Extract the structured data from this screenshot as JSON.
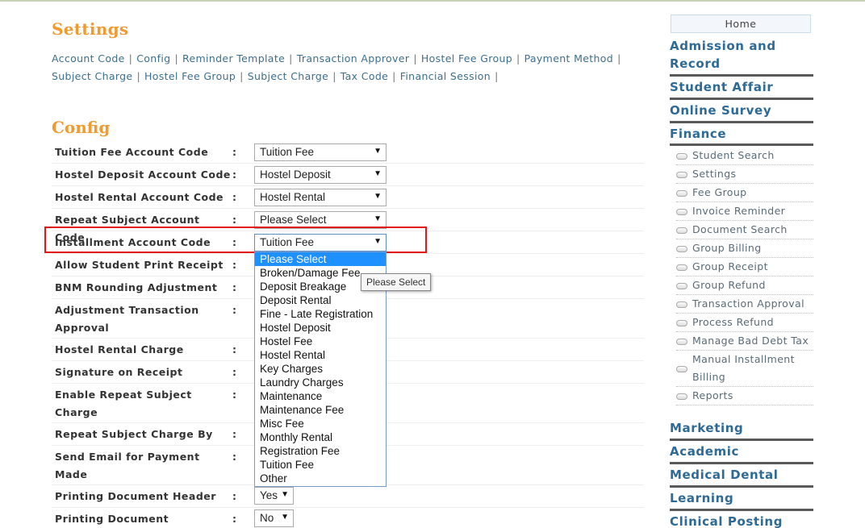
{
  "settings": {
    "title": "Settings",
    "links_row1": [
      "Account Code",
      "Config",
      "Reminder Template",
      "Transaction Approver",
      "Hostel Fee Group",
      "Payment Method"
    ],
    "links_row2": [
      "Subject Charge",
      "Hostel Fee Group",
      "Subject Charge",
      "Tax Code",
      "Financial Session"
    ]
  },
  "config": {
    "title": "Config",
    "colon": ":",
    "rows": [
      {
        "label": "Tuition Fee Account Code",
        "value": "Tuition Fee"
      },
      {
        "label": "Hostel Deposit Account Code",
        "value": "Hostel Deposit"
      },
      {
        "label": "Hostel Rental Account Code",
        "value": "Hostel Rental"
      },
      {
        "label": "Repeat Subject Account Code",
        "value": "Please Select"
      },
      {
        "label": "Installment Account Code",
        "value": "Tuition Fee"
      },
      {
        "label": "Allow Student Print Receipt",
        "value": ""
      },
      {
        "label": "BNM Rounding Adjustment",
        "value": ""
      },
      {
        "label": "Adjustment Transaction Approval",
        "value": ""
      },
      {
        "label": "Hostel Rental Charge",
        "value": ""
      },
      {
        "label": "Signature on Receipt",
        "value": ""
      },
      {
        "label": "Enable Repeat Subject Charge",
        "value": ""
      },
      {
        "label": "Repeat Subject Charge By",
        "value": ""
      },
      {
        "label": "Send Email for Payment Made",
        "value": ""
      },
      {
        "label": "Printing Document Header",
        "value": "Yes"
      },
      {
        "label": "Printing Document",
        "value": "No"
      }
    ],
    "dropdown_arrow": "▼"
  },
  "dropdown": {
    "options": [
      "Please Select",
      "Broken/Damage Fee",
      "Deposit Breakage",
      "Deposit Rental",
      "Fine - Late Registration",
      "Hostel Deposit",
      "Hostel Fee",
      "Hostel Rental",
      "Key Charges",
      "Laundry Charges",
      "Maintenance",
      "Maintenance Fee",
      "Misc Fee",
      "Monthly Rental",
      "Registration Fee",
      "Tuition Fee",
      "Other"
    ],
    "highlighted": "Please Select",
    "tooltip": "Please Select"
  },
  "sidebar": {
    "home": "Home",
    "sections_top": [
      "Admission and Record",
      "Student Affair",
      "Online Survey",
      "Finance"
    ],
    "finance_items": [
      "Student Search",
      "Settings",
      "Fee Group",
      "Invoice Reminder",
      "Document Search",
      "Group Billing",
      "Group Receipt",
      "Group Refund",
      "Transaction Approval",
      "Process Refund",
      "Manage Bad Debt Tax",
      "Manual Installment Billing",
      "Reports"
    ],
    "sections_bottom": [
      "Marketing",
      "Academic",
      "Medical Dental",
      "Learning",
      "Clinical Posting"
    ]
  },
  "colors": {
    "heading_orange": "#f39a2e",
    "link_blue": "#3d6f8e",
    "sidebar_blue": "#2d6a96",
    "highlight_red": "#e01818",
    "selected_option": "#1e90ff"
  }
}
